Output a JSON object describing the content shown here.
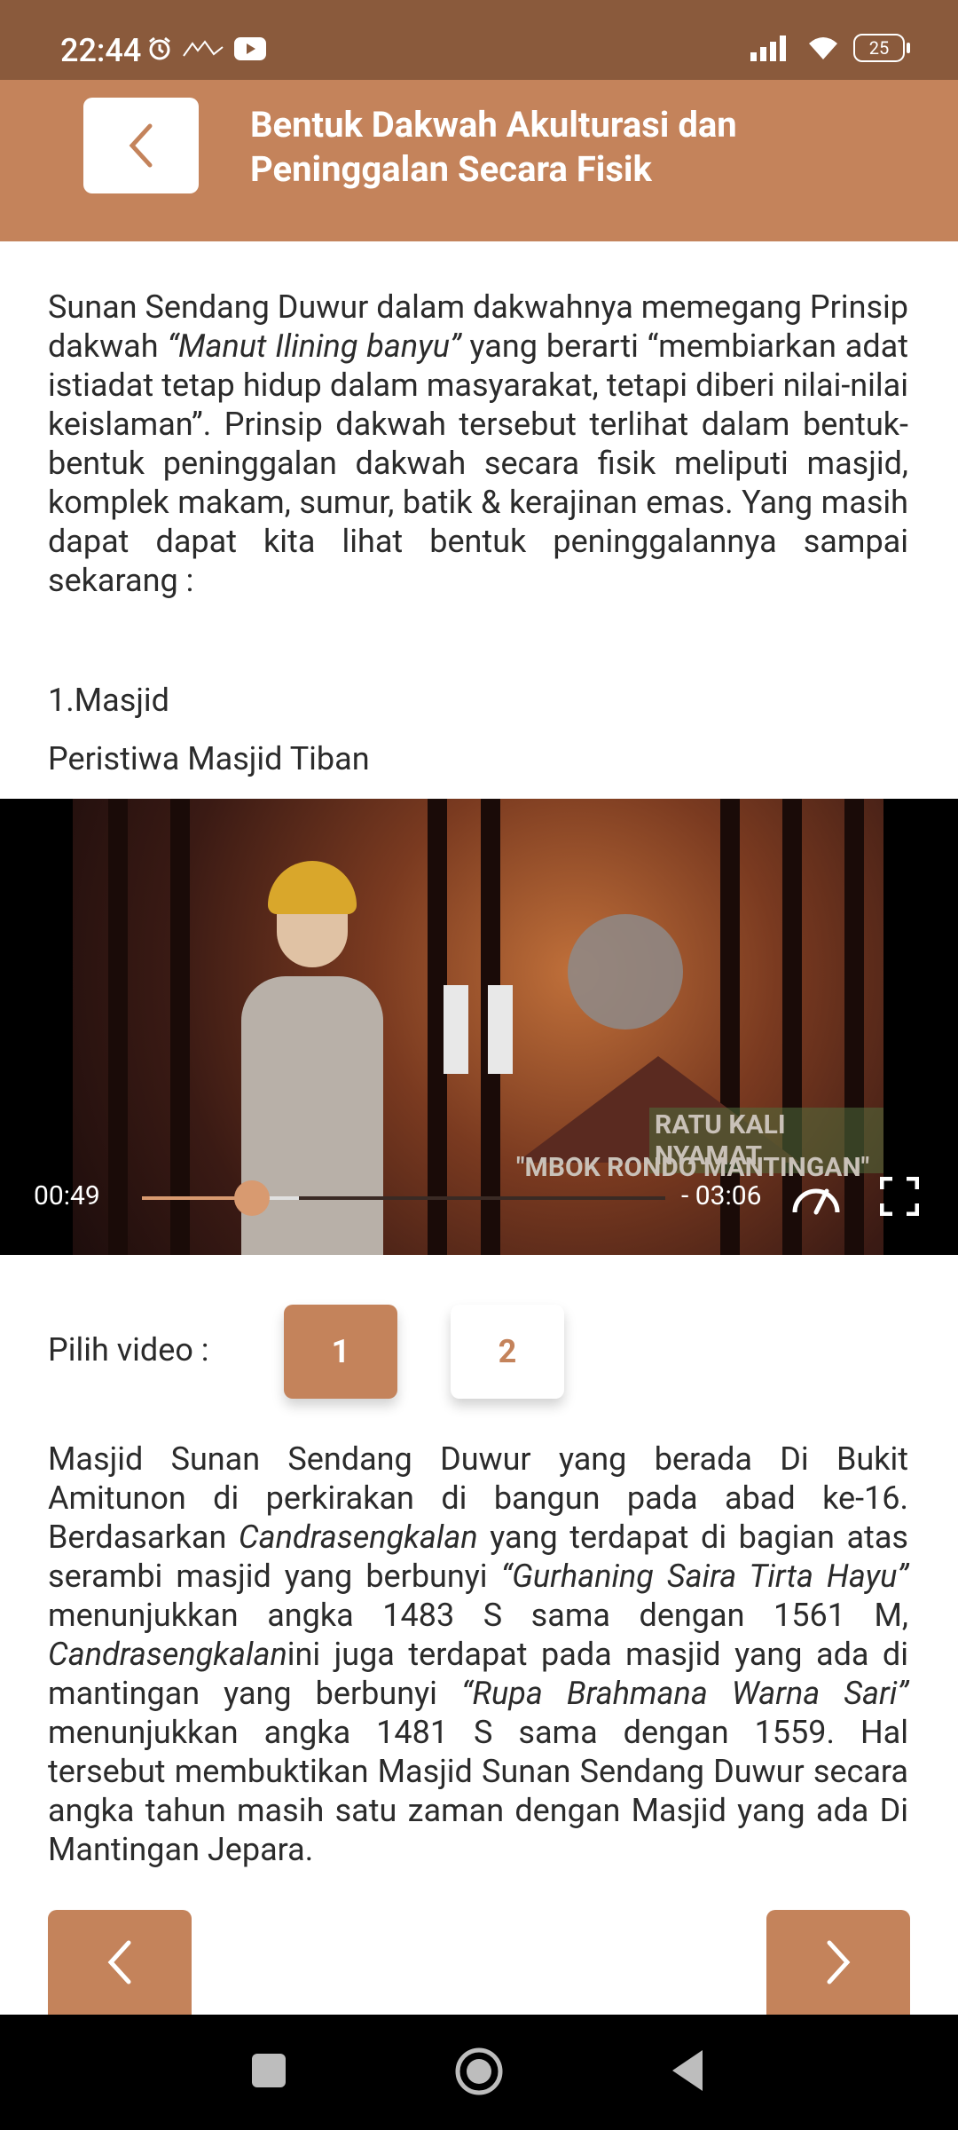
{
  "status_bar": {
    "time": "22:44",
    "battery": "25"
  },
  "header": {
    "title_line1": "Bentuk Dakwah Akulturasi dan",
    "title_line2": "Peninggalan Secara Fisik"
  },
  "content": {
    "intro_paragraph": {
      "part1": "Sunan Sendang Duwur dalam dakwahnya memegang Prinsip dakwah ",
      "italic1": "“Manut Ilining banyu”",
      "part2": " yang berarti “membiarkan adat istiadat tetap hidup dalam masyarakat, tetapi diberi nilai-nilai keislaman”. Prinsip dakwah tersebut terlihat dalam bentuk-bentuk peninggalan dakwah secara fisik meliputi masjid, komplek makam, sumur, batik & kerajinan emas. Yang masih dapat dapat kita lihat bentuk peninggalannya sampai sekarang :"
    },
    "section_heading": "1.Masjid",
    "video_title": "Peristiwa Masjid Tiban"
  },
  "video": {
    "caption_line1": "RATU KALI NYAMAT",
    "caption_line2": "\"MBOK RONDO MANTINGAN\"",
    "elapsed": "00:49",
    "remaining": "- 03:06",
    "progress": 0.21,
    "buffered": 0.3
  },
  "picker": {
    "label": "Pilih video :",
    "options": [
      "1",
      "2"
    ],
    "selected": "1"
  },
  "masjid_paragraph": {
    "p1": "Masjid Sunan Sendang Duwur yang berada Di Bukit Amitunon di perkirakan di bangun pada abad ke-16. Berdasarkan ",
    "i1": "Candrasengkalan",
    "p2": " yang terdapat di bagian atas serambi masjid yang berbunyi ",
    "i2": "“Gurhaning Saira Tirta Hayu”",
    "p3": " menunjukkan angka 1483 S sama dengan 1561 M, ",
    "i3": "Candrasengkalan",
    "p4": "ini juga terdapat pada masjid yang ada di mantingan yang berbunyi ",
    "i4": "“Rupa Brahmana Warna Sari”",
    "p5": " menunjukkan angka 1481 S sama dengan 1559. Hal tersebut membuktikan Masjid Sunan Sendang Duwur secara angka tahun masih satu zaman dengan Masjid yang ada Di Mantingan Jepara."
  },
  "colors": {
    "status_bar": "#8a5a3c",
    "accent": "#c4835b"
  }
}
